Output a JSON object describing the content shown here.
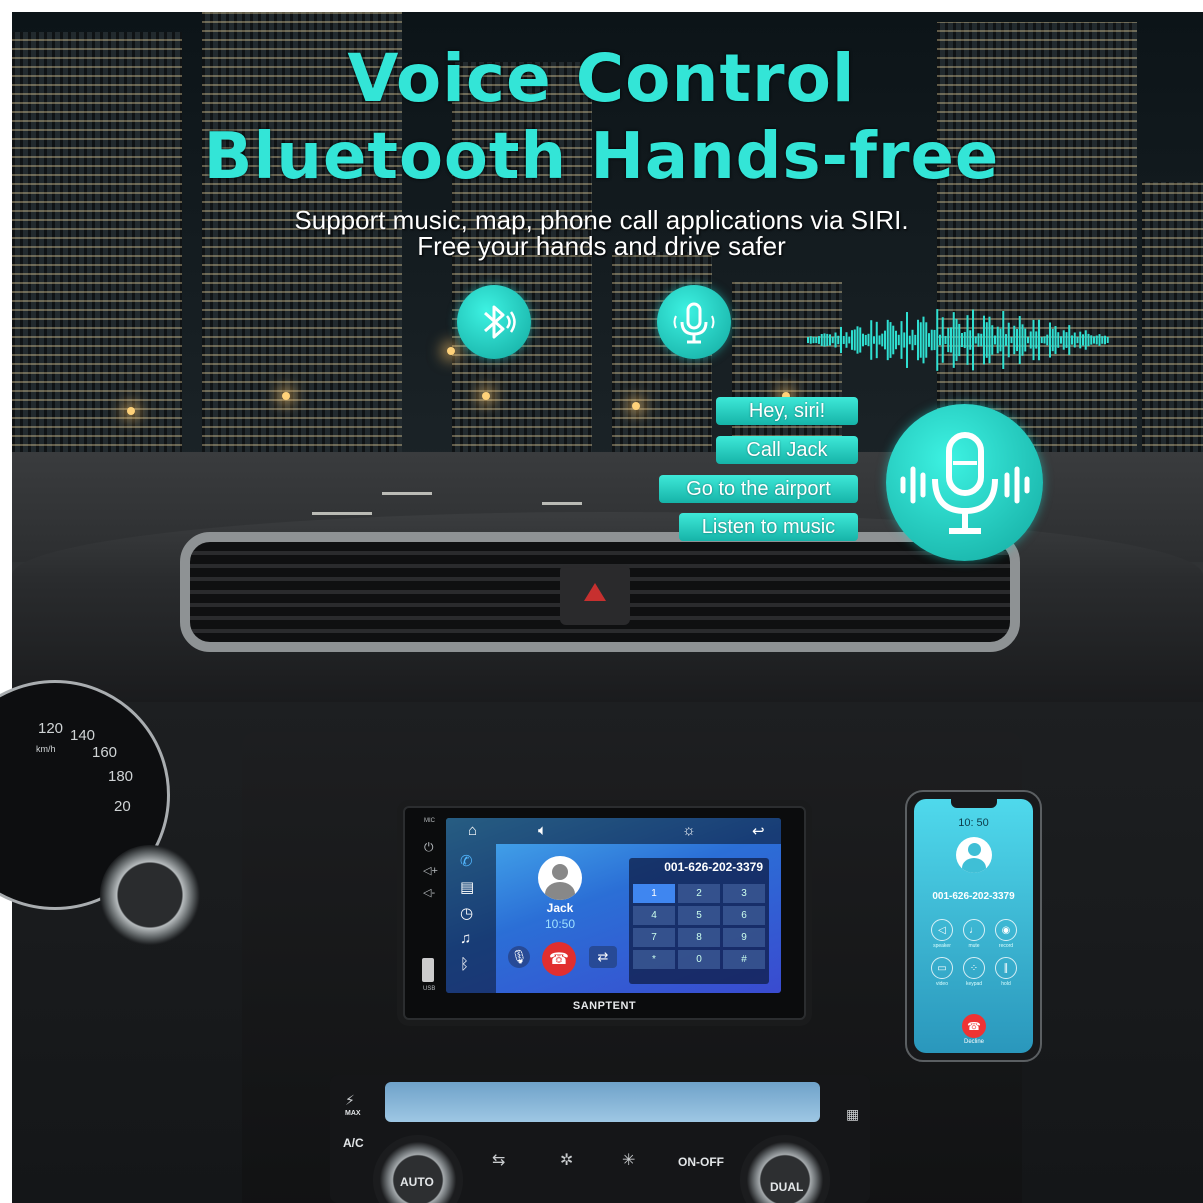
{
  "header": {
    "title_line1": "Voice Control",
    "title_line2": "Bluetooth Hands-free",
    "subtitle_line1": "Support music, map, phone call applications via SIRI.",
    "subtitle_line2": "Free your hands and drive safer"
  },
  "icons": {
    "bluetooth": "bluetooth-icon",
    "microphone_small": "microphone-icon",
    "microphone_large": "microphone-large-icon",
    "soundwave": "soundwave-graphic"
  },
  "voice_commands": [
    "Hey, siri!",
    "Call Jack",
    "Go to the airport",
    "Listen to music"
  ],
  "gauge": {
    "labels": [
      "120",
      "140",
      "160",
      "180",
      "20"
    ],
    "unit": "km/h"
  },
  "head_unit": {
    "brand": "SANPTENT",
    "contact_name": "Jack",
    "call_time": "10:50",
    "dialed_number": "001-626-202-3379",
    "keypad": [
      "1",
      "2",
      "3",
      "4",
      "5",
      "6",
      "7",
      "8",
      "9",
      "*",
      "0",
      "#"
    ],
    "side_labels": [
      "MIC",
      "USB"
    ]
  },
  "phone": {
    "time": "10: 50",
    "number": "001-626-202-3379",
    "buttons": [
      "speaker",
      "mute",
      "record",
      "video",
      "keypad",
      "hold"
    ],
    "decline_label": "Decline"
  },
  "climate": {
    "auto_label": "AUTO",
    "dual_label": "DUAL",
    "onoff_label": "ON-OFF",
    "ac_label": "A/C",
    "max_label": "MAX"
  },
  "colors": {
    "accent": "#33e5d7",
    "pill": "#22c7bb",
    "decline": "#e33333"
  }
}
